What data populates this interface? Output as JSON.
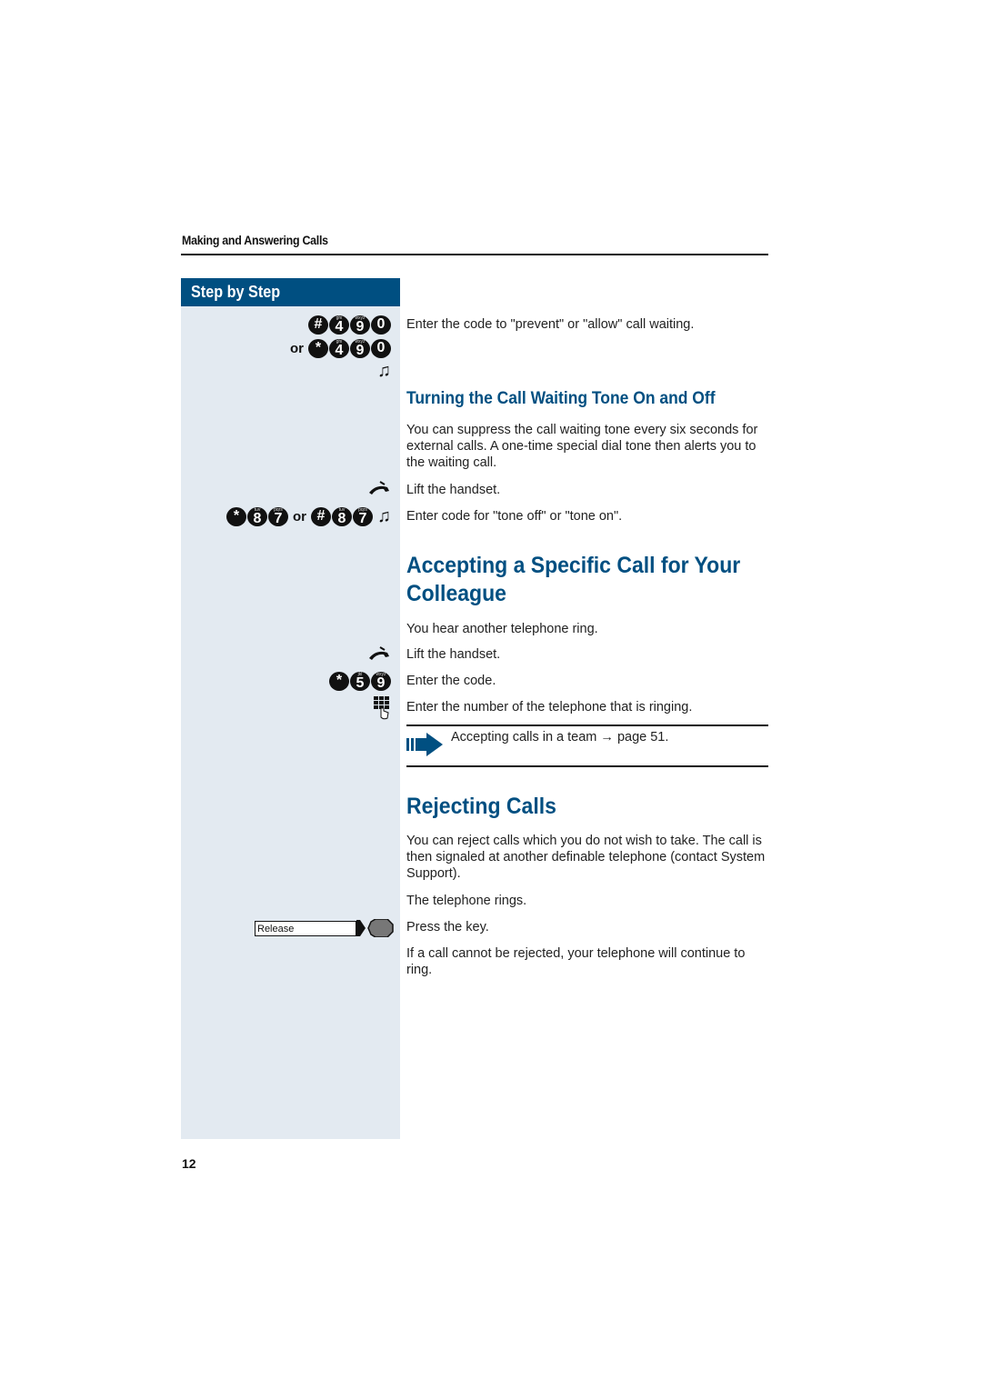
{
  "header": {
    "running_title": "Making and Answering Calls"
  },
  "sidebar": {
    "title": "Step by Step",
    "codes": {
      "prevent_allow_1": [
        {
          "k": "#",
          "s": ""
        },
        {
          "k": "4",
          "s": "ghi"
        },
        {
          "k": "9",
          "s": "wxyz"
        },
        {
          "k": "0",
          "s": ""
        }
      ],
      "or_label": "or",
      "prevent_allow_2": [
        {
          "k": "*",
          "s": ""
        },
        {
          "k": "4",
          "s": "ghi"
        },
        {
          "k": "9",
          "s": "wxyz"
        },
        {
          "k": "0",
          "s": ""
        }
      ],
      "tone_off": [
        {
          "k": "*",
          "s": ""
        },
        {
          "k": "8",
          "s": "tuv"
        },
        {
          "k": "7",
          "s": "pqrs"
        }
      ],
      "tone_on": [
        {
          "k": "#",
          "s": ""
        },
        {
          "k": "8",
          "s": "tuv"
        },
        {
          "k": "7",
          "s": "pqrs"
        }
      ],
      "pickup": [
        {
          "k": "*",
          "s": ""
        },
        {
          "k": "5",
          "s": "jkl"
        },
        {
          "k": "9",
          "s": "wxyz"
        }
      ]
    },
    "release_key_label": "Release",
    "icons": {
      "tone": "musical-note-icon",
      "handset": "lift-handset-icon",
      "keypad": "keypad-icon",
      "softkey": "softkey-icon",
      "note": "note-arrow-icon"
    }
  },
  "content": {
    "step_enter_code_waiting": "Enter the code to \"prevent\" or \"allow\" call waiting.",
    "section1": {
      "title": "Turning the Call Waiting Tone On and Off",
      "intro": "You can suppress the call waiting tone every six seconds for external calls. A one-time special dial tone then alerts you to the waiting call.",
      "step_lift": "Lift the handset.",
      "step_code": "Enter code for \"tone off\" or \"tone on\"."
    },
    "section2": {
      "title": "Accepting a Specific Call for Your Colleague",
      "intro": "You hear another telephone ring.",
      "step_lift": "Lift the handset.",
      "step_code": "Enter the code.",
      "step_number": "Enter the number of the telephone that is ringing.",
      "note": "Accepting calls in a team → page 51."
    },
    "section3": {
      "title": "Rejecting Calls",
      "intro": "You can reject calls which you do not wish to take. The call is then signaled at another definable telephone (contact System Support).",
      "step_rings": "The telephone rings.",
      "step_press": "Press the key.",
      "outro": "If a call cannot be rejected, your telephone will continue to ring."
    }
  },
  "footer": {
    "page_number": "12"
  },
  "colors": {
    "accent": "#004f81",
    "sidebar_bg": "#e3eaf1"
  }
}
